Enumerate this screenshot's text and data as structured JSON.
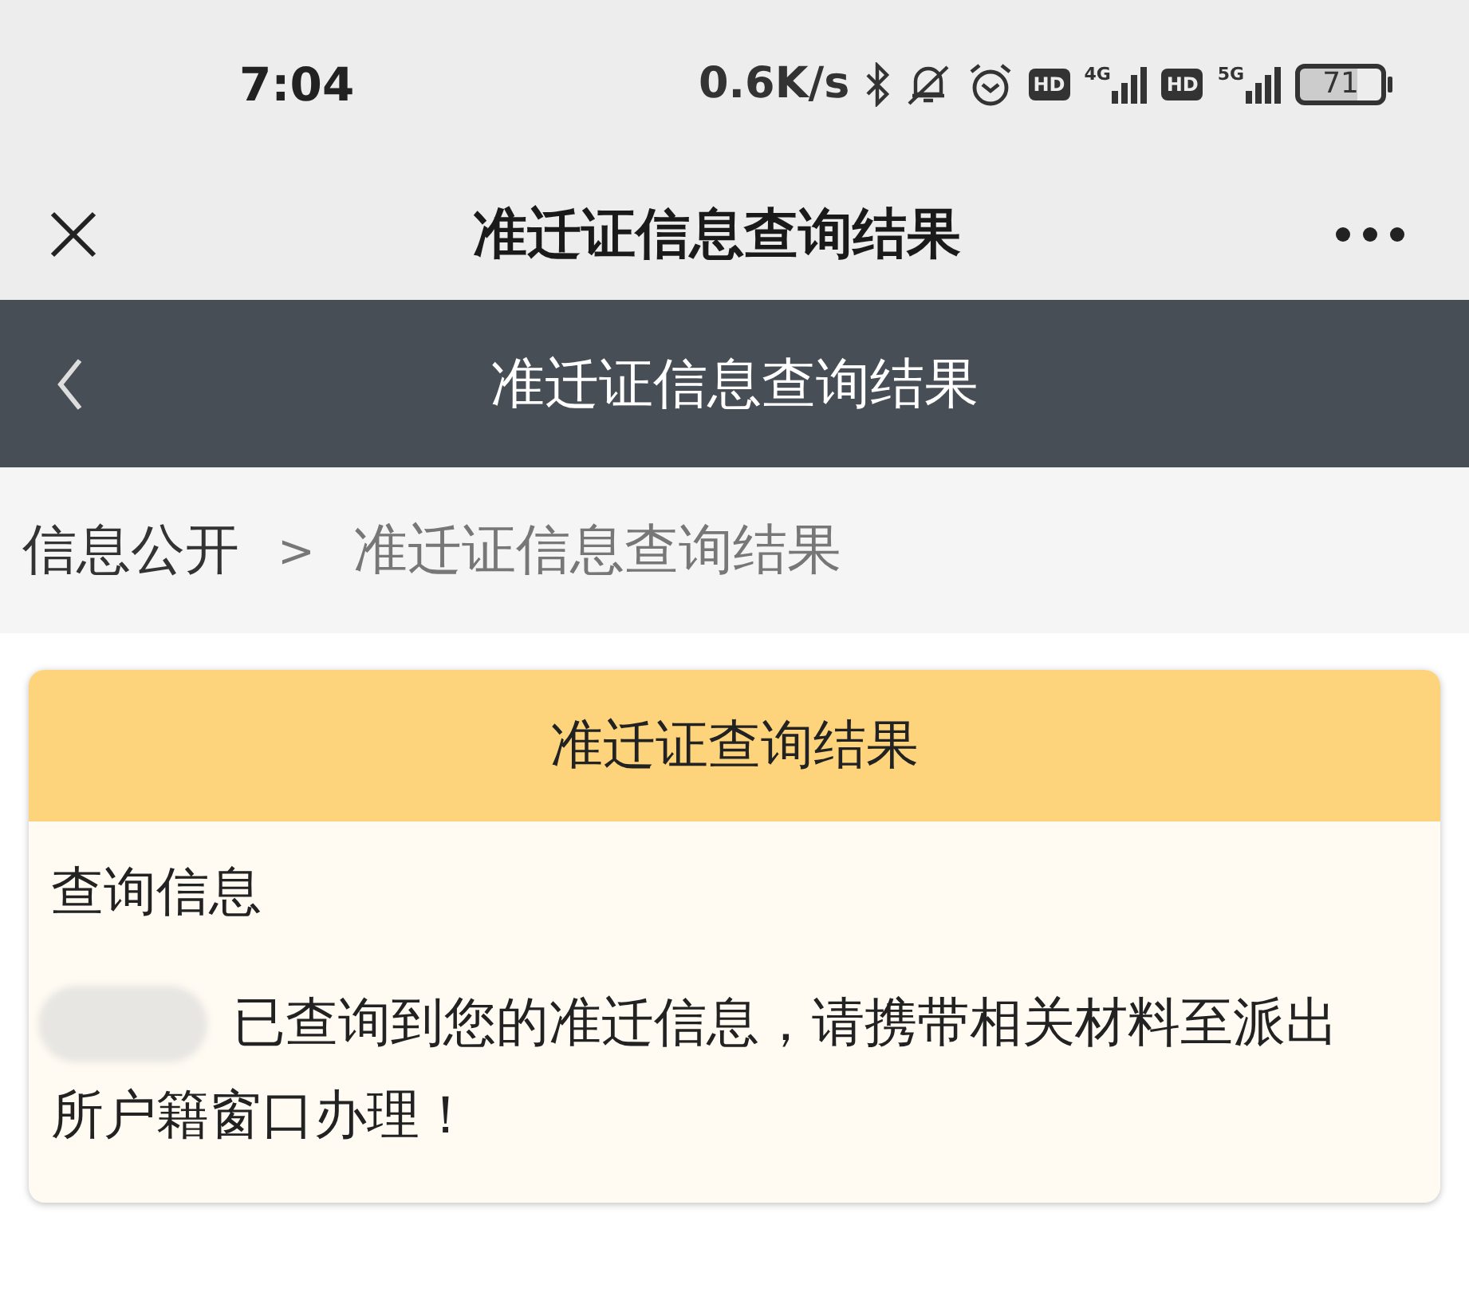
{
  "status_bar": {
    "time": "7:04",
    "speed": "0.6K/s",
    "badges": [
      {
        "text": "HD",
        "network": "4G"
      },
      {
        "text": "HD",
        "network": "5G"
      }
    ],
    "battery": "71"
  },
  "top_bar": {
    "title": "准迁证信息查询结果"
  },
  "header": {
    "title": "准迁证信息查询结果"
  },
  "breadcrumb": [
    {
      "label": "信息公开",
      "current": false
    },
    {
      "label": ">",
      "kind": "separator"
    },
    {
      "label": "准迁证信息查询结果",
      "current": true
    }
  ],
  "card": {
    "title": "准迁证查询结果",
    "section": "查询信息",
    "message": "已查询到您的准迁信息，请携带相关材料至派出所户籍窗口办理！",
    "redacted": true
  }
}
